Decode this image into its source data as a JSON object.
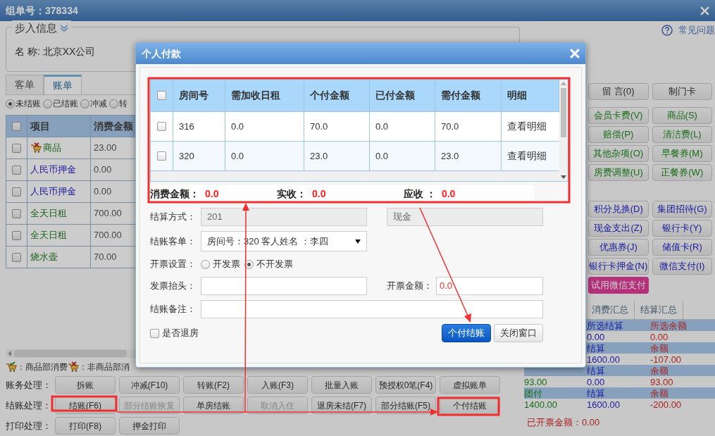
{
  "window": {
    "title": "组单号：378334"
  },
  "help_link": "常见问题",
  "guest_info": {
    "legend": "步入信息",
    "name_label": "名 称:",
    "name_value": "北京XX公司"
  },
  "tabs": [
    {
      "label": "客单",
      "selected": false
    },
    {
      "label": "账单",
      "selected": true
    }
  ],
  "filters": [
    {
      "label": "未结账",
      "selected": true
    },
    {
      "label": "已结账",
      "selected": false
    },
    {
      "label": "冲减",
      "selected": false
    },
    {
      "label": "转",
      "selected": false
    }
  ],
  "bill_table": {
    "all_checked": false,
    "columns": [
      "项目",
      "消费金额"
    ],
    "rows": [
      {
        "kind": "goods",
        "checked": false,
        "item": "商品",
        "amount": "23.00"
      },
      {
        "kind": "deposit",
        "checked": false,
        "item": "人民币押金",
        "amount": "0.00"
      },
      {
        "kind": "deposit",
        "checked": false,
        "item": "人民币押金",
        "amount": "0.00"
      },
      {
        "kind": "charge",
        "checked": false,
        "item": "全天日租",
        "amount": "700.00"
      },
      {
        "kind": "charge",
        "checked": false,
        "item": "全天日租",
        "amount": "700.00"
      },
      {
        "kind": "charge",
        "checked": false,
        "item": "烧水壶",
        "amount": "70.00"
      }
    ]
  },
  "legend": {
    "goods_label": "：商品部消费",
    "other_label": "：非商品部消"
  },
  "action_rows": [
    {
      "label": "账务处理：",
      "buttons": [
        {
          "label": "拆账",
          "disabled": false
        },
        {
          "label": "冲减(F10)",
          "disabled": false
        },
        {
          "label": "转账(F2)",
          "disabled": false
        },
        {
          "label": "入账(F3)",
          "disabled": false
        },
        {
          "label": "批量入账",
          "disabled": false
        },
        {
          "label": "预授权0笔(F4)",
          "disabled": false
        },
        {
          "label": "虚拟账单",
          "disabled": false
        }
      ]
    },
    {
      "label": "结账处理：",
      "buttons": [
        {
          "label": "结账(F6)",
          "disabled": false
        },
        {
          "label": "部分结账恢复",
          "disabled": true
        },
        {
          "label": "单房结账",
          "disabled": false
        },
        {
          "label": "取消入住",
          "disabled": true
        },
        {
          "label": "退房未结(F7)",
          "disabled": false
        },
        {
          "label": "部分结账(F5)",
          "disabled": false
        },
        {
          "label": "个付结账",
          "disabled": false
        }
      ]
    },
    {
      "label": "打印处理：",
      "buttons": [
        {
          "label": "打印(F8)",
          "disabled": false
        },
        {
          "label": "押金打印",
          "disabled": false
        }
      ]
    }
  ],
  "side_buttons": [
    {
      "kind": "plain",
      "buttons": [
        "留 言(0)",
        "制门卡"
      ]
    },
    {
      "kind": "charge",
      "buttons": [
        "会员卡费(V)",
        "商品(S)",
        "赔偿(P)",
        "清洁费(L)",
        "其他杂项(O)",
        "早餐券(M)",
        "房费调整(U)",
        "正餐券(W)"
      ]
    },
    {
      "kind": "payment",
      "buttons": [
        "积分兑换(D)",
        "集团招待(G)",
        "现金支出(Z)",
        "银行卡(Y)",
        "优惠券(J)",
        "储值卡(R)",
        "银行卡押金(N)",
        "微信支付(I)"
      ]
    },
    {
      "kind": "promo",
      "buttons": [
        "试用微信支付"
      ]
    }
  ],
  "summary_tabs": [
    "消费汇总",
    "结算汇总"
  ],
  "summary_rows": [
    {
      "kind": "header",
      "settle": "所选结算",
      "balance": "所选余额"
    },
    {
      "kind": "value",
      "settle": "0.00",
      "balance": "0.00"
    },
    {
      "kind": "header",
      "settle": "结算",
      "balance": "余额"
    },
    {
      "kind": "value",
      "settle": "1600.00",
      "balance": "-107.00"
    },
    {
      "kind": "header",
      "settle": "结算",
      "balance": "余额"
    },
    {
      "kind": "value",
      "consume": "93.00",
      "settle": "0.00",
      "balance": "93.00"
    },
    {
      "kind": "header",
      "consume": "团付",
      "settle": "结算",
      "balance": "余额"
    },
    {
      "kind": "value",
      "consume": "1400.00",
      "settle": "1600.00",
      "balance": "-200.00"
    }
  ],
  "invoiced": {
    "label": "已开票金额：",
    "value": "0.00"
  },
  "dialog": {
    "title": "个人付款",
    "table": {
      "all_checked": false,
      "columns": [
        "房间号",
        "需加收日租",
        "个付金额",
        "已付金额",
        "需付金额",
        "明细"
      ],
      "rows": [
        {
          "checked": false,
          "cells": [
            "316",
            "0.0",
            "70.0",
            "0.0",
            "70.0"
          ],
          "link": "查看明细"
        },
        {
          "checked": false,
          "cells": [
            "320",
            "0.0",
            "23.0",
            "0.0",
            "23.0"
          ],
          "link": "查看明细"
        }
      ]
    },
    "totals": [
      {
        "label": "消费金额：",
        "value": "0.0"
      },
      {
        "label": "实收：",
        "value": "0.0"
      },
      {
        "label": "应收 ：",
        "value": "0.0"
      }
    ],
    "form": {
      "settle_label": "结算方式：",
      "settle_value": "201",
      "method_value": "现金",
      "guest_label": "结账客单：",
      "guest_value": "房间号：320 客人姓名 ：李四",
      "invoice_label": "开票设置：",
      "invoice_options": [
        {
          "label": "开发票",
          "selected": false
        },
        {
          "label": "不开发票",
          "selected": true
        }
      ],
      "title_label": "发票抬头：",
      "amount_label": "开票金额：",
      "amount_value": "0.0",
      "note_label": "结账备注："
    },
    "checkout": {
      "label": "是否退房",
      "checked": false
    },
    "buttons": [
      {
        "label": "个付结账",
        "kind": "primary"
      },
      {
        "label": "关闭窗口",
        "kind": "default"
      }
    ]
  }
}
